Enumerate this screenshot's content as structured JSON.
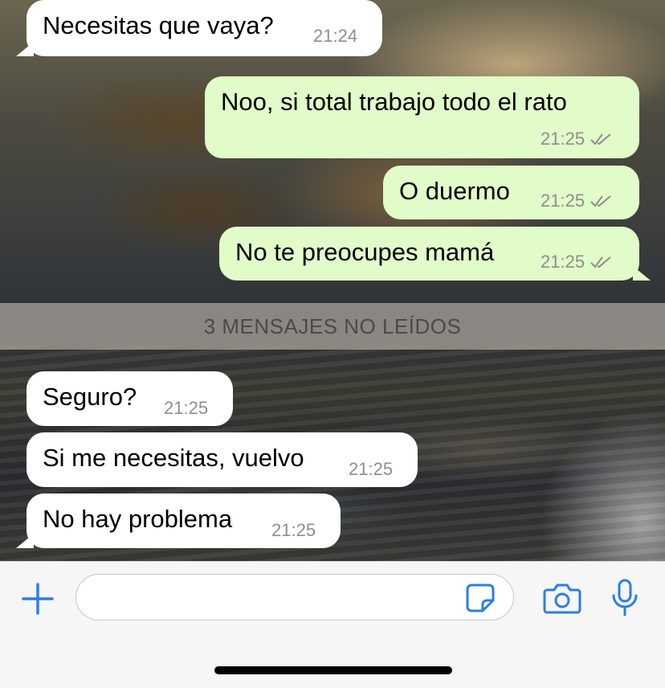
{
  "messages": [
    {
      "direction": "in",
      "text": "Necesitas que vaya?",
      "time": "21:24"
    },
    {
      "direction": "out",
      "text": "Noo, si total trabajo todo el rato",
      "time": "21:25",
      "status": "read"
    },
    {
      "direction": "out",
      "text": "O duermo",
      "time": "21:25",
      "status": "read"
    },
    {
      "direction": "out",
      "text": "No te preocupes mamá",
      "time": "21:25",
      "status": "read"
    },
    {
      "direction": "in",
      "text": "Seguro?",
      "time": "21:25"
    },
    {
      "direction": "in",
      "text": "Si me necesitas, vuelvo",
      "time": "21:25"
    },
    {
      "direction": "in",
      "text": "No hay problema",
      "time": "21:25"
    }
  ],
  "unread_divider": "3 MENSAJES NO LEÍDOS",
  "composer": {
    "value": "",
    "icons": [
      "plus-icon",
      "sticker-icon",
      "camera-icon",
      "microphone-icon"
    ]
  },
  "colors": {
    "incoming_bubble": "#ffffff",
    "outgoing_bubble": "#e1fbc9",
    "accent": "#2b7de9",
    "timestamp": "#8e8e8e"
  }
}
